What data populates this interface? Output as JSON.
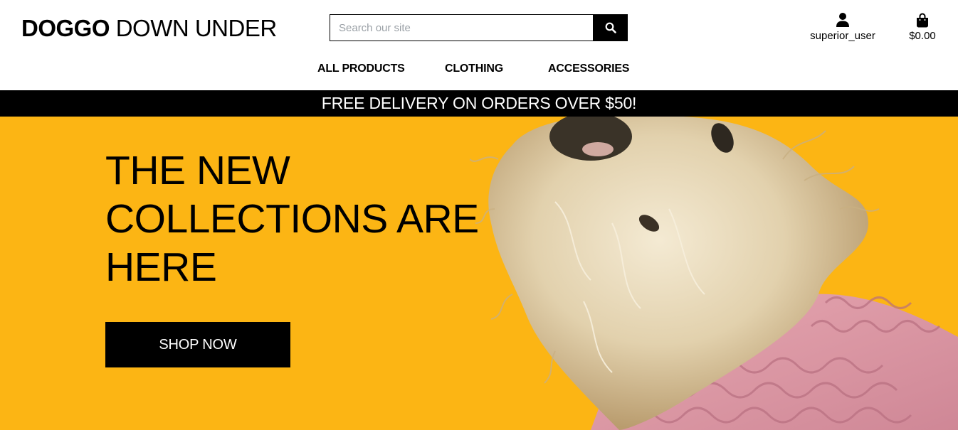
{
  "header": {
    "logo_bold": "DOGGO",
    "logo_light": "DOWN UNDER",
    "search_placeholder": "Search our site",
    "search_icon": "magnifier-icon",
    "account_icon": "user-icon",
    "account_label": "superior_user",
    "bag_icon": "shopping-bag-icon",
    "bag_total": "$0.00"
  },
  "nav": {
    "items": [
      {
        "label": "ALL PRODUCTS"
      },
      {
        "label": "CLOTHING"
      },
      {
        "label": "ACCESSORIES"
      }
    ]
  },
  "banner": {
    "text": "FREE DELIVERY ON ORDERS OVER $50!"
  },
  "hero": {
    "title_lines": [
      "THE NEW",
      "COLLECTIONS ARE",
      "HERE"
    ],
    "button_label": "SHOP NOW",
    "background_color": "#fcb514"
  }
}
